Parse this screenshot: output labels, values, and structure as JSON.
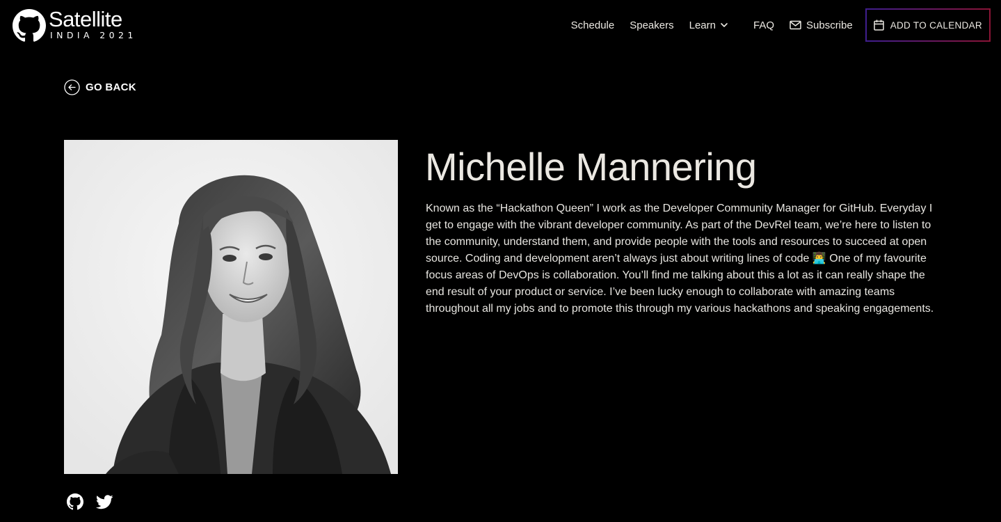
{
  "header": {
    "logo_title": "Satellite",
    "logo_subtitle": "INDIA 2021",
    "nav": {
      "schedule": "Schedule",
      "speakers": "Speakers",
      "learn": "Learn",
      "faq": "FAQ",
      "subscribe": "Subscribe"
    },
    "add_to_calendar": "ADD TO CALENDAR"
  },
  "go_back": "GO BACK",
  "speaker": {
    "name": "Michelle Mannering",
    "bio": "Known as the “Hackathon Queen” I work as the Developer Community Manager for GitHub. Everyday I get to engage with the vibrant developer community. As part of the DevRel team, we’re here to listen to the community, understand them, and provide people with the tools and resources to succeed at open source. Coding and development aren’t always just about writing lines of code 👨‍💻 One of my favourite focus areas of DevOps is collaboration. You’ll find me talking about this a lot as it can really shape the end result of your product or service. I’ve been lucky enough to collaborate with amazing teams throughout all my jobs and to promote this through my various hackathons and speaking engagements.",
    "photo_icon": "speaker-photo",
    "socials": [
      "github-icon",
      "twitter-icon"
    ]
  },
  "colors": {
    "background": "#000000",
    "text": "#e8e6e1",
    "button_border_start": "#3f1e8f",
    "button_border_end": "#8b1436"
  }
}
